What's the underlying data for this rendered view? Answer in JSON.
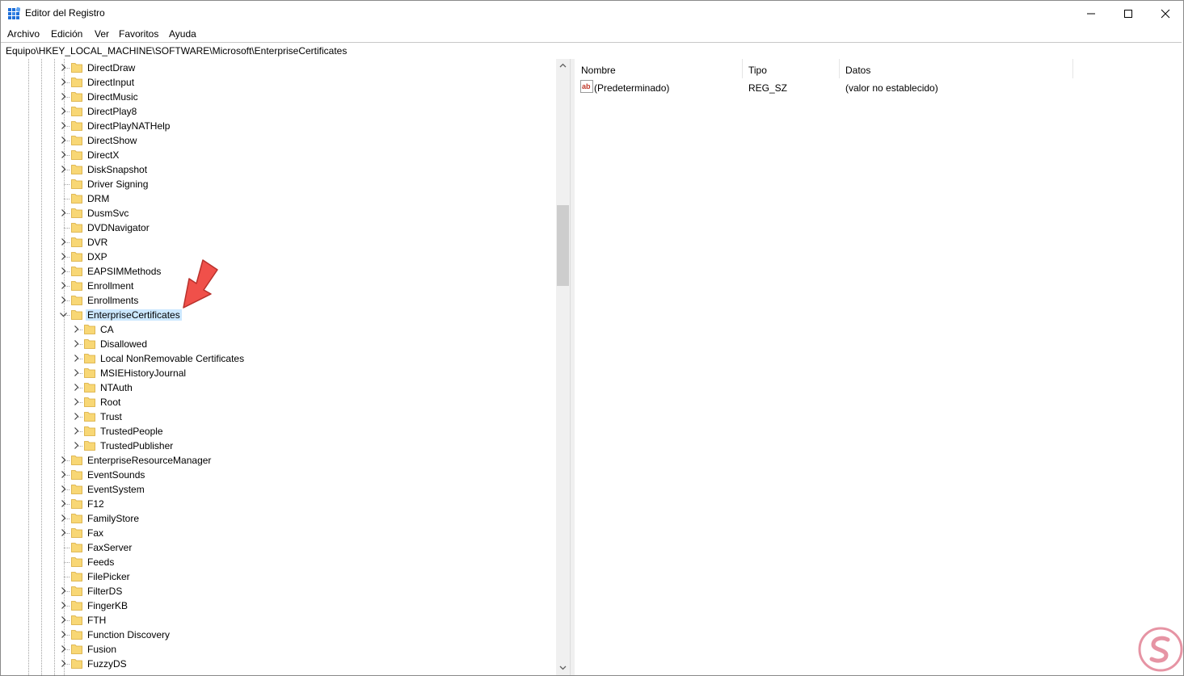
{
  "window": {
    "title": "Editor del Registro",
    "controls": {
      "minimize": "minimize",
      "maximize": "maximize",
      "close": "close"
    }
  },
  "menu": [
    "Archivo",
    "Edición",
    "Ver",
    "Favoritos",
    "Ayuda"
  ],
  "address": "Equipo\\HKEY_LOCAL_MACHINE\\SOFTWARE\\Microsoft\\EnterpriseCertificates",
  "tree": [
    {
      "label": "DirectDraw",
      "level": 0,
      "expander": "collapsed"
    },
    {
      "label": "DirectInput",
      "level": 0,
      "expander": "collapsed"
    },
    {
      "label": "DirectMusic",
      "level": 0,
      "expander": "collapsed"
    },
    {
      "label": "DirectPlay8",
      "level": 0,
      "expander": "collapsed"
    },
    {
      "label": "DirectPlayNATHelp",
      "level": 0,
      "expander": "collapsed"
    },
    {
      "label": "DirectShow",
      "level": 0,
      "expander": "collapsed"
    },
    {
      "label": "DirectX",
      "level": 0,
      "expander": "collapsed"
    },
    {
      "label": "DiskSnapshot",
      "level": 0,
      "expander": "collapsed"
    },
    {
      "label": "Driver Signing",
      "level": 0,
      "expander": "none"
    },
    {
      "label": "DRM",
      "level": 0,
      "expander": "none"
    },
    {
      "label": "DusmSvc",
      "level": 0,
      "expander": "collapsed"
    },
    {
      "label": "DVDNavigator",
      "level": 0,
      "expander": "none"
    },
    {
      "label": "DVR",
      "level": 0,
      "expander": "collapsed"
    },
    {
      "label": "DXP",
      "level": 0,
      "expander": "collapsed"
    },
    {
      "label": "EAPSIMMethods",
      "level": 0,
      "expander": "collapsed"
    },
    {
      "label": "Enrollment",
      "level": 0,
      "expander": "collapsed"
    },
    {
      "label": "Enrollments",
      "level": 0,
      "expander": "collapsed"
    },
    {
      "label": "EnterpriseCertificates",
      "level": 0,
      "expander": "expanded",
      "selected": true
    },
    {
      "label": "CA",
      "level": 1,
      "expander": "collapsed"
    },
    {
      "label": "Disallowed",
      "level": 1,
      "expander": "collapsed"
    },
    {
      "label": "Local NonRemovable Certificates",
      "level": 1,
      "expander": "collapsed"
    },
    {
      "label": "MSIEHistoryJournal",
      "level": 1,
      "expander": "collapsed"
    },
    {
      "label": "NTAuth",
      "level": 1,
      "expander": "collapsed"
    },
    {
      "label": "Root",
      "level": 1,
      "expander": "collapsed"
    },
    {
      "label": "Trust",
      "level": 1,
      "expander": "collapsed"
    },
    {
      "label": "TrustedPeople",
      "level": 1,
      "expander": "collapsed"
    },
    {
      "label": "TrustedPublisher",
      "level": 1,
      "expander": "collapsed"
    },
    {
      "label": "EnterpriseResourceManager",
      "level": 0,
      "expander": "collapsed"
    },
    {
      "label": "EventSounds",
      "level": 0,
      "expander": "collapsed"
    },
    {
      "label": "EventSystem",
      "level": 0,
      "expander": "collapsed"
    },
    {
      "label": "F12",
      "level": 0,
      "expander": "collapsed"
    },
    {
      "label": "FamilyStore",
      "level": 0,
      "expander": "collapsed"
    },
    {
      "label": "Fax",
      "level": 0,
      "expander": "collapsed"
    },
    {
      "label": "FaxServer",
      "level": 0,
      "expander": "none"
    },
    {
      "label": "Feeds",
      "level": 0,
      "expander": "none"
    },
    {
      "label": "FilePicker",
      "level": 0,
      "expander": "none"
    },
    {
      "label": "FilterDS",
      "level": 0,
      "expander": "collapsed"
    },
    {
      "label": "FingerKB",
      "level": 0,
      "expander": "collapsed"
    },
    {
      "label": "FTH",
      "level": 0,
      "expander": "collapsed"
    },
    {
      "label": "Function Discovery",
      "level": 0,
      "expander": "collapsed"
    },
    {
      "label": "Fusion",
      "level": 0,
      "expander": "collapsed"
    },
    {
      "label": "FuzzyDS",
      "level": 0,
      "expander": "collapsed"
    }
  ],
  "columns": {
    "name": "Nombre",
    "type": "Tipo",
    "data": "Datos"
  },
  "values": [
    {
      "icon": "string-value-icon",
      "name": "(Predeterminado)",
      "type": "REG_SZ",
      "data": "(valor no establecido)"
    }
  ],
  "colors": {
    "selection": "#cce8ff",
    "folder": "#f8d775",
    "annotation_arrow": "#f0504a",
    "watermark": "#d23c5a"
  }
}
